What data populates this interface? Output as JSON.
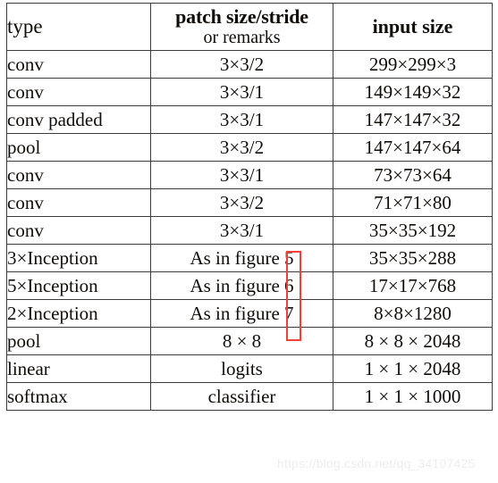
{
  "table": {
    "headers": {
      "type": "type",
      "patch_line1": "patch size/stride",
      "patch_line2": "or remarks",
      "input": "input size"
    },
    "rows": [
      {
        "type": "conv",
        "patch": "3×3/2",
        "input": "299×299×3"
      },
      {
        "type": "conv",
        "patch": "3×3/1",
        "input": "149×149×32"
      },
      {
        "type": "conv padded",
        "patch": "3×3/1",
        "input": "147×147×32"
      },
      {
        "type": "pool",
        "patch": "3×3/2",
        "input": "147×147×64"
      },
      {
        "type": "conv",
        "patch": "3×3/1",
        "input": "73×73×64"
      },
      {
        "type": "conv",
        "patch": "3×3/2",
        "input": "71×71×80"
      },
      {
        "type": "conv",
        "patch": "3×3/1",
        "input": "35×35×192"
      },
      {
        "type": "3×Inception",
        "patch_prefix": "As in figure ",
        "fignum": "5",
        "input": "35×35×288"
      },
      {
        "type": "5×Inception",
        "patch_prefix": "As in figure ",
        "fignum": "6",
        "input": "17×17×768"
      },
      {
        "type": "2×Inception",
        "patch_prefix": "As in figure ",
        "fignum": "7",
        "input": "8×8×1280"
      },
      {
        "type": "pool",
        "patch": "8 × 8",
        "input": "8 × 8 × 2048"
      },
      {
        "type": "linear",
        "patch": "logits",
        "input": "1 × 1 × 2048"
      },
      {
        "type": "softmax",
        "patch": "classifier",
        "input": "1 × 1 × 1000"
      }
    ]
  },
  "annotation": {
    "highlight_color": "#ef4136",
    "highlight_target": "figure-number-column"
  },
  "watermark": {
    "text": "https://blog.csdn.net/qq_34107425"
  }
}
